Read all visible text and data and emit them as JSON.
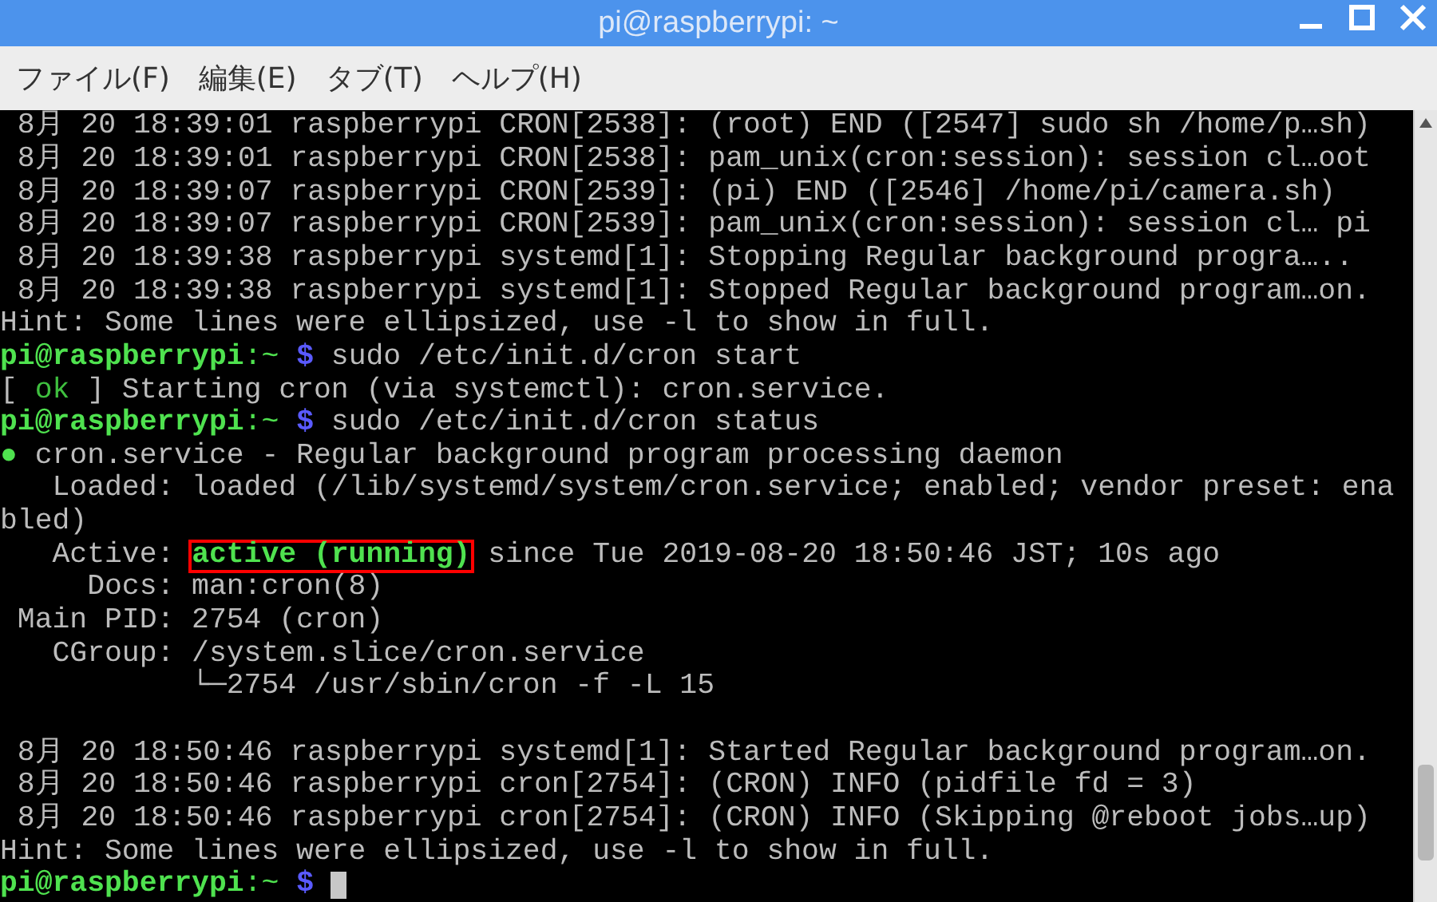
{
  "window": {
    "title": "pi@raspberrypi: ~"
  },
  "menu": [
    "ファイル(F)",
    "編集(E)",
    "タブ(T)",
    "ヘルプ(H)"
  ],
  "terminal": {
    "lines": [
      {
        "kind": "text",
        "segments": [
          {
            "kind": "plain",
            "text": " 8月 20 18:39:01 raspberrypi CRON[2538]: (root) END ([2547] sudo sh /home/p…sh)"
          }
        ]
      },
      {
        "kind": "text",
        "segments": [
          {
            "kind": "plain",
            "text": " 8月 20 18:39:01 raspberrypi CRON[2538]: pam_unix(cron:session): session cl…oot"
          }
        ]
      },
      {
        "kind": "text",
        "segments": [
          {
            "kind": "plain",
            "text": " 8月 20 18:39:07 raspberrypi CRON[2539]: (pi) END ([2546] /home/pi/camera.sh)"
          }
        ]
      },
      {
        "kind": "text",
        "segments": [
          {
            "kind": "plain",
            "text": " 8月 20 18:39:07 raspberrypi CRON[2539]: pam_unix(cron:session): session cl… pi"
          }
        ]
      },
      {
        "kind": "text",
        "segments": [
          {
            "kind": "plain",
            "text": " 8月 20 18:39:38 raspberrypi systemd[1]: Stopping Regular background progra….."
          }
        ]
      },
      {
        "kind": "text",
        "segments": [
          {
            "kind": "plain",
            "text": " 8月 20 18:39:38 raspberrypi systemd[1]: Stopped Regular background program…on."
          }
        ]
      },
      {
        "kind": "text",
        "segments": [
          {
            "kind": "plain",
            "text": "Hint: Some lines were ellipsized, use -l to show in full."
          }
        ]
      },
      {
        "kind": "text",
        "segments": [
          {
            "kind": "user",
            "text": "pi@raspberrypi"
          },
          {
            "kind": "path",
            "text": ":~ "
          },
          {
            "kind": "sign",
            "text": "$"
          },
          {
            "kind": "plain",
            "text": " sudo /etc/init.d/cron start"
          }
        ]
      },
      {
        "kind": "text",
        "segments": [
          {
            "kind": "plain",
            "text": "[ "
          },
          {
            "kind": "ok",
            "text": "ok"
          },
          {
            "kind": "plain",
            "text": " ] Starting cron (via systemctl): cron.service."
          }
        ]
      },
      {
        "kind": "text",
        "segments": [
          {
            "kind": "user",
            "text": "pi@raspberrypi"
          },
          {
            "kind": "path",
            "text": ":~ "
          },
          {
            "kind": "sign",
            "text": "$"
          },
          {
            "kind": "plain",
            "text": " sudo /etc/init.d/cron status"
          }
        ]
      },
      {
        "kind": "text",
        "segments": [
          {
            "kind": "dot",
            "text": "●"
          },
          {
            "kind": "plain",
            "text": " cron.service - Regular background program processing daemon"
          }
        ]
      },
      {
        "kind": "text",
        "segments": [
          {
            "kind": "plain",
            "text": "   Loaded: loaded (/lib/systemd/system/cron.service; enabled; vendor preset: ena"
          }
        ]
      },
      {
        "kind": "text",
        "segments": [
          {
            "kind": "plain",
            "text": "bled)"
          }
        ]
      },
      {
        "kind": "text",
        "segments": [
          {
            "kind": "plain",
            "text": "   Active: "
          },
          {
            "kind": "active",
            "text": "active (running)"
          },
          {
            "kind": "plain",
            "text": " since Tue 2019-08-20 18:50:46 JST; 10s ago"
          }
        ]
      },
      {
        "kind": "text",
        "segments": [
          {
            "kind": "plain",
            "text": "     Docs: man:cron(8)"
          }
        ]
      },
      {
        "kind": "text",
        "segments": [
          {
            "kind": "plain",
            "text": " Main PID: 2754 (cron)"
          }
        ]
      },
      {
        "kind": "text",
        "segments": [
          {
            "kind": "plain",
            "text": "   CGroup: /system.slice/cron.service"
          }
        ]
      },
      {
        "kind": "text",
        "segments": [
          {
            "kind": "plain",
            "text": "           └─2754 /usr/sbin/cron -f -L 15"
          }
        ]
      },
      {
        "kind": "blank"
      },
      {
        "kind": "text",
        "segments": [
          {
            "kind": "plain",
            "text": " 8月 20 18:50:46 raspberrypi systemd[1]: Started Regular background program…on."
          }
        ]
      },
      {
        "kind": "text",
        "segments": [
          {
            "kind": "plain",
            "text": " 8月 20 18:50:46 raspberrypi cron[2754]: (CRON) INFO (pidfile fd = 3)"
          }
        ]
      },
      {
        "kind": "text",
        "segments": [
          {
            "kind": "plain",
            "text": " 8月 20 18:50:46 raspberrypi cron[2754]: (CRON) INFO (Skipping @reboot jobs…up)"
          }
        ]
      },
      {
        "kind": "text",
        "segments": [
          {
            "kind": "plain",
            "text": "Hint: Some lines were ellipsized, use -l to show in full."
          }
        ]
      },
      {
        "kind": "text",
        "segments": [
          {
            "kind": "user",
            "text": "pi@raspberrypi"
          },
          {
            "kind": "path",
            "text": ":~ "
          },
          {
            "kind": "sign",
            "text": "$"
          }
        ],
        "cursor": true
      }
    ]
  }
}
